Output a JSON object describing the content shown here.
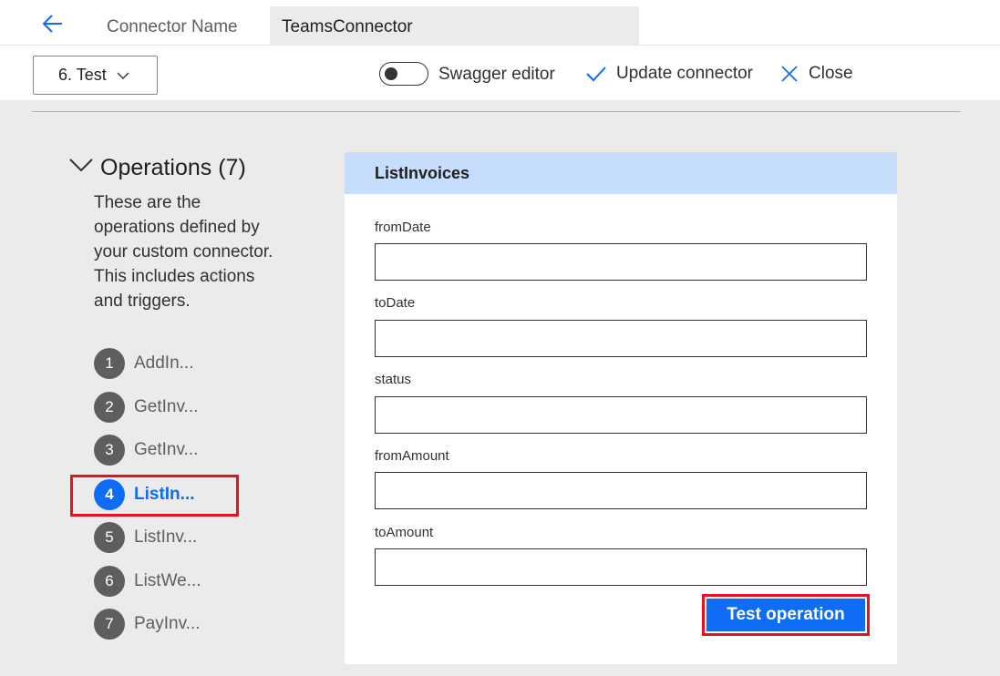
{
  "header": {
    "connector_name_label": "Connector Name",
    "connector_name_value": "TeamsConnector"
  },
  "toolbar": {
    "step_selector": "6. Test",
    "swagger_label": "Swagger editor",
    "swagger_enabled": false,
    "update_label": "Update connector",
    "close_label": "Close"
  },
  "operations": {
    "title": "Operations (7)",
    "description": "These are the operations defined by your custom connector. This includes actions and triggers.",
    "items": [
      {
        "num": "1",
        "label": "AddIn..."
      },
      {
        "num": "2",
        "label": "GetInv..."
      },
      {
        "num": "3",
        "label": "GetInv..."
      },
      {
        "num": "4",
        "label": "ListIn..."
      },
      {
        "num": "5",
        "label": "ListInv..."
      },
      {
        "num": "6",
        "label": "ListWe..."
      },
      {
        "num": "7",
        "label": "PayInv..."
      }
    ],
    "active_index": 3
  },
  "card": {
    "title": "ListInvoices",
    "fields": [
      {
        "label": "fromDate",
        "value": ""
      },
      {
        "label": "toDate",
        "value": ""
      },
      {
        "label": "status",
        "value": ""
      },
      {
        "label": "fromAmount",
        "value": ""
      },
      {
        "label": "toAmount",
        "value": ""
      }
    ],
    "test_button": "Test operation"
  },
  "colors": {
    "accent": "#0f6cf5",
    "highlight": "#e81123",
    "card_header": "#c7ddfc",
    "background": "#ebebeb"
  },
  "icons": {
    "back": "back-arrow-icon",
    "dropdown": "chevron-down-icon",
    "update": "checkmark-icon",
    "close": "close-icon",
    "collapse": "chevron-down-icon"
  }
}
